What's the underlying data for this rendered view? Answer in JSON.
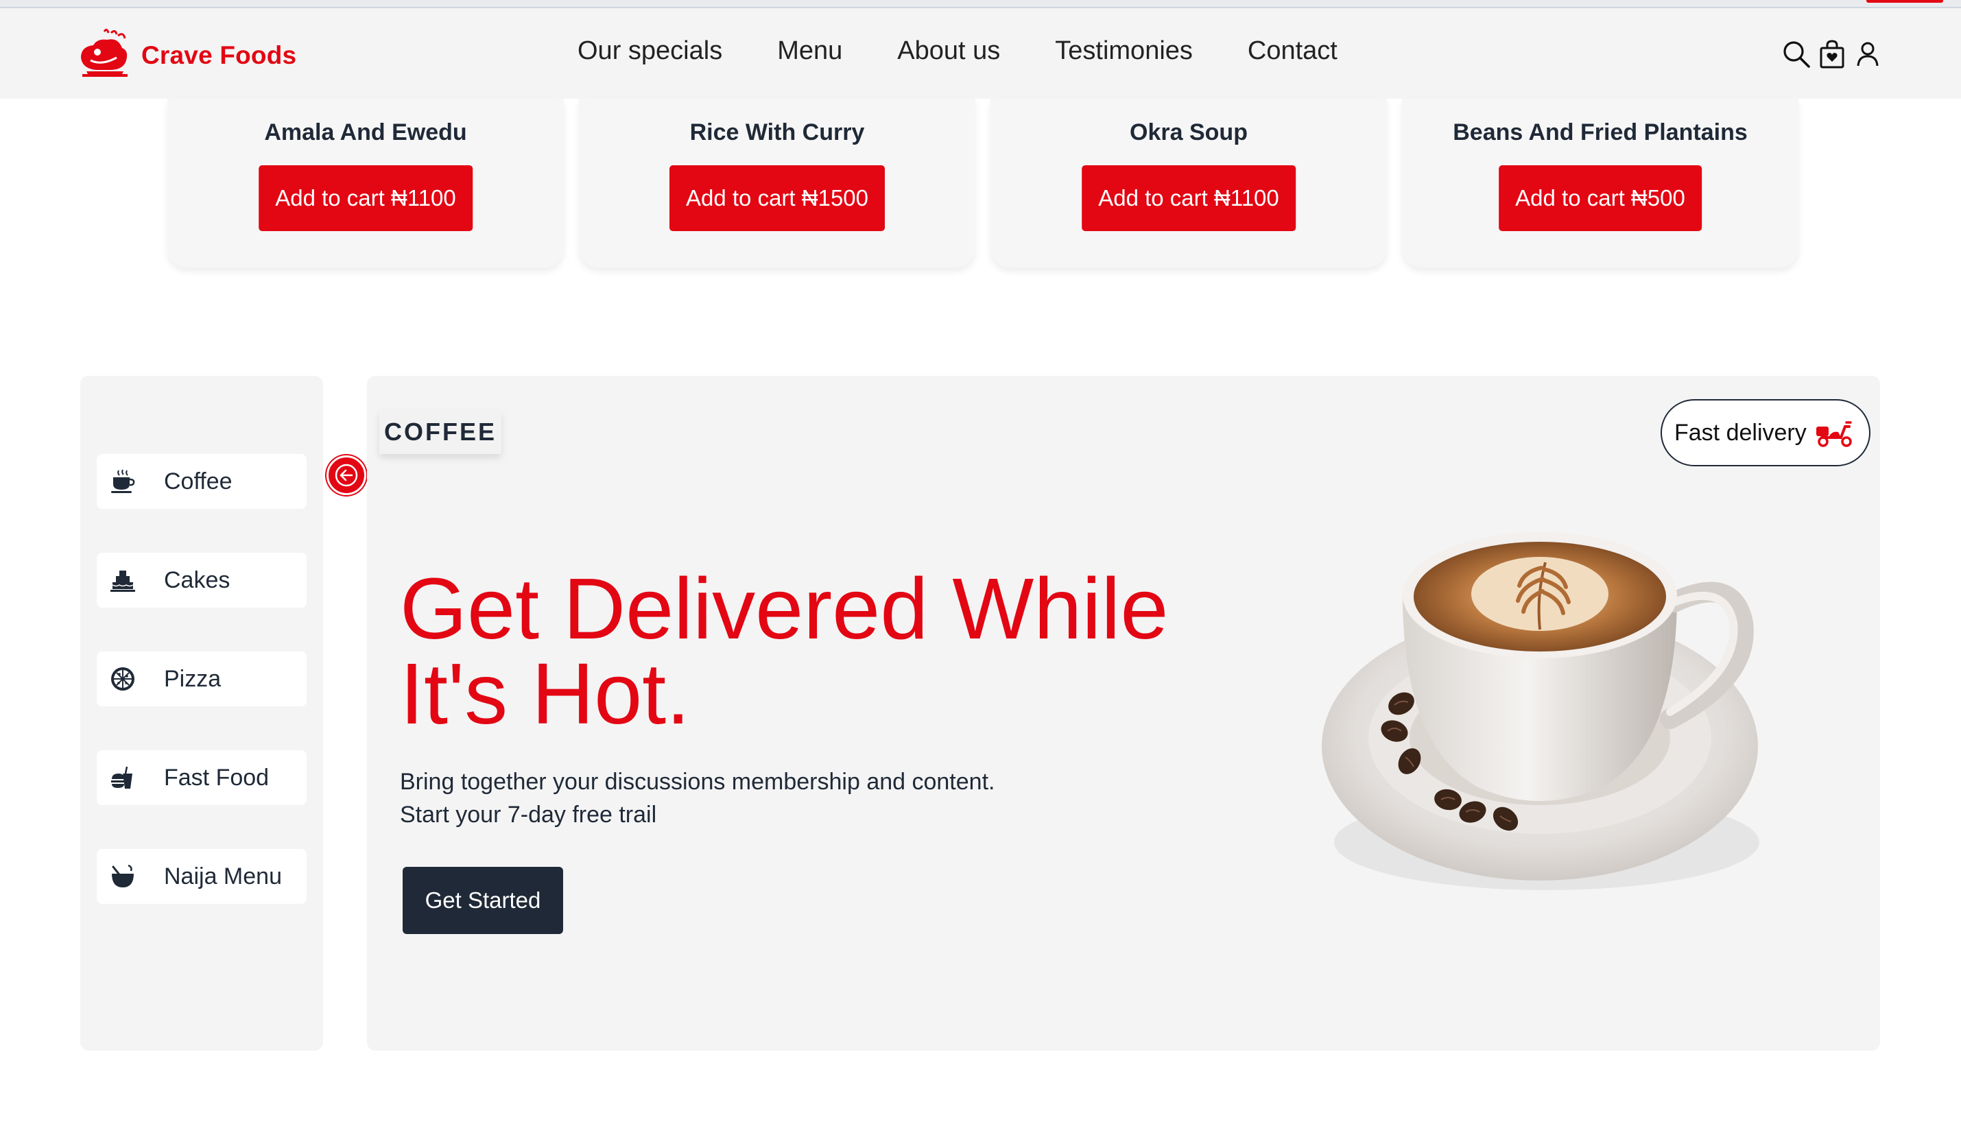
{
  "brand": {
    "name": "Crave Foods",
    "color": "#e30613"
  },
  "nav": {
    "links": [
      "Our specials",
      "Menu",
      "About us",
      "Testimonies",
      "Contact"
    ]
  },
  "header_icons": [
    "search-icon",
    "shopping-bag-icon",
    "user-icon"
  ],
  "products": [
    {
      "name": "Amala And Ewedu",
      "button": "Add to cart ₦1100"
    },
    {
      "name": "Rice With Curry",
      "button": "Add to cart ₦1500"
    },
    {
      "name": "Okra Soup",
      "button": "Add to cart ₦1100"
    },
    {
      "name": "Beans And Fried Plantains",
      "button": "Add to cart ₦500"
    }
  ],
  "categories": [
    {
      "label": "Coffee",
      "icon": "coffee-cup-icon"
    },
    {
      "label": "Cakes",
      "icon": "cake-icon"
    },
    {
      "label": "Pizza",
      "icon": "pizza-icon"
    },
    {
      "label": "Fast Food",
      "icon": "fast-food-icon"
    },
    {
      "label": "Naija Menu",
      "icon": "pot-icon"
    }
  ],
  "hero": {
    "tag": "COFFEE",
    "badge": "Fast delivery",
    "headline": "Get Delivered While It's Hot.",
    "subtext_line1": "Bring together your discussions membership and content.",
    "subtext_line2": "Start your 7-day free trail",
    "cta": "Get Started",
    "image": "coffee-cup-image"
  },
  "colors": {
    "accent": "#e30613",
    "dark": "#1f2937",
    "panel": "#f4f4f4"
  }
}
